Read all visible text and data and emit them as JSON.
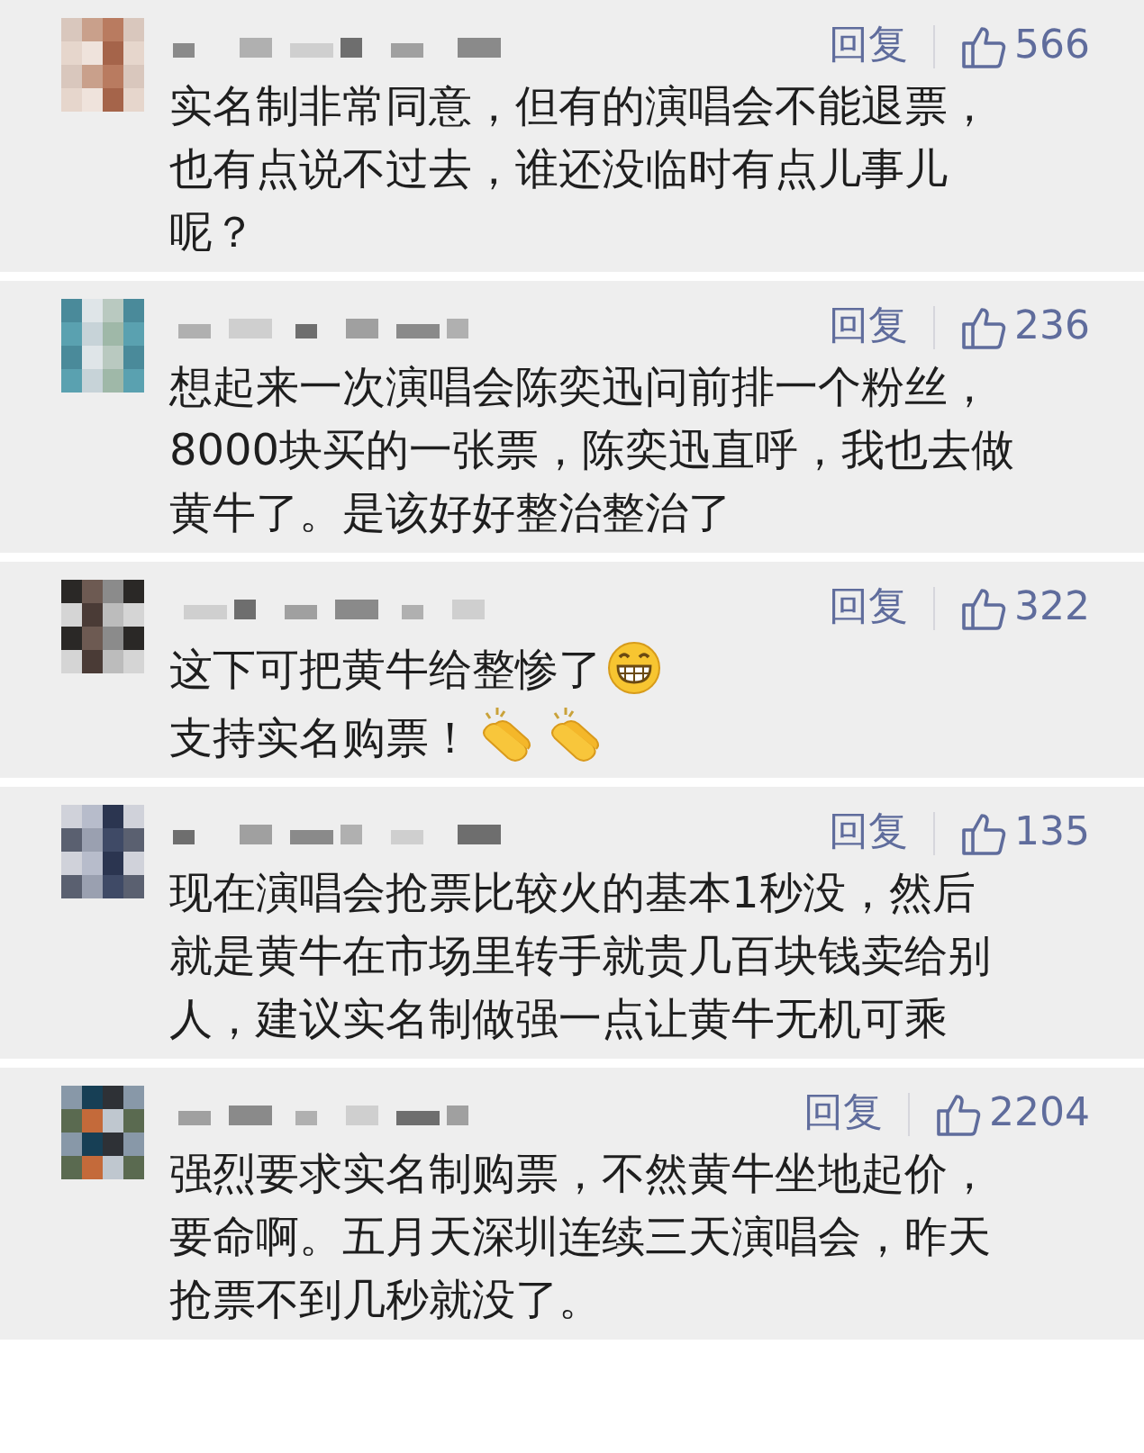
{
  "comments": [
    {
      "reply": "回复",
      "likes": "566",
      "body": [
        {
          "kind": "text",
          "text": "实名制非常同意，但有的演唱会不能退票，也有点说不过去，谁还没临时有点儿事儿呢？"
        }
      ]
    },
    {
      "reply": "回复",
      "likes": "236",
      "body": [
        {
          "kind": "text",
          "text": "想起来一次演唱会陈奕迅问前排一个粉丝，8000块买的一张票，陈奕迅直呼，我也去做黄牛了。是该好好整治整治了"
        }
      ]
    },
    {
      "reply": "回复",
      "likes": "322",
      "body": [
        {
          "kind": "text",
          "text": "这下可把黄牛给整惨了"
        },
        {
          "kind": "grin"
        },
        {
          "kind": "break"
        },
        {
          "kind": "text",
          "text": "支持实名购票！"
        },
        {
          "kind": "clap"
        },
        {
          "kind": "clap"
        }
      ]
    },
    {
      "reply": "回复",
      "likes": "135",
      "body": [
        {
          "kind": "text",
          "text": "现在演唱会抢票比较火的基本1秒没，然后就是黄牛在市场里转手就贵几百块钱卖给别人，建议实名制做强一点让黄牛无机可乘"
        }
      ]
    },
    {
      "reply": "回复",
      "likes": "2204",
      "body": [
        {
          "kind": "text",
          "text": "强烈要求实名制购票，不然黄牛坐地起价，要命啊。五月天深圳连续三天演唱会，昨天抢票不到几秒就没了。"
        }
      ]
    }
  ]
}
